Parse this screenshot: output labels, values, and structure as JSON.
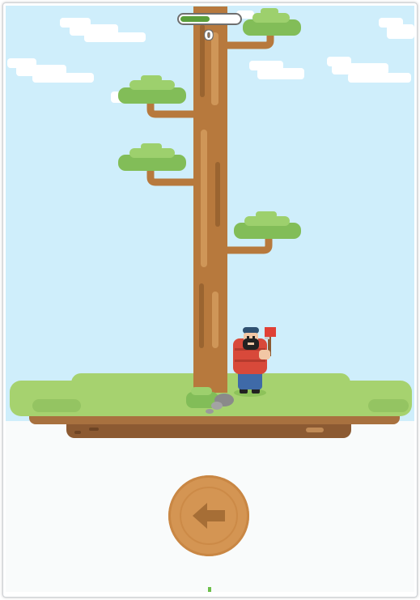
{
  "game": {
    "score": "0",
    "timer_fill_fraction": 0.5,
    "controls": {
      "chop_button_icon": "arrow-left-icon",
      "chop_direction": "left"
    },
    "player_side": "right",
    "branches": [
      {
        "side": "right",
        "level": 1
      },
      {
        "side": "left",
        "level": 2
      },
      {
        "side": "left",
        "level": 3
      },
      {
        "side": "right",
        "level": 5
      }
    ]
  },
  "colors": {
    "sky": "#cfeefb",
    "grass": "#a6d26f",
    "trunk": "#b7793d",
    "leaves": "#82bd58",
    "button": "#d49553",
    "shirt": "#d8493a",
    "pants": "#3f6aa8"
  }
}
